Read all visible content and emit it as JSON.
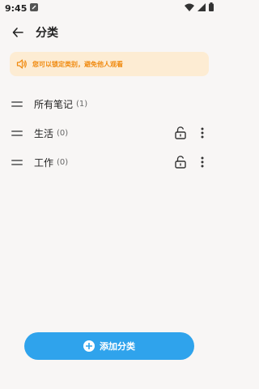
{
  "status": {
    "time": "9:45"
  },
  "header": {
    "title": "分类"
  },
  "tip": {
    "text": "您可以锁定类别，避免他人观看"
  },
  "categories": [
    {
      "name": "所有笔记",
      "count": "(1)",
      "lockable": false
    },
    {
      "name": "生活",
      "count": "(0)",
      "lockable": true
    },
    {
      "name": "工作",
      "count": "(0)",
      "lockable": true
    }
  ],
  "add_button": {
    "label": "添加分类"
  },
  "colors": {
    "accent": "#2fa3ec",
    "tip_bg": "#fdecd3",
    "tip_text": "#f08a0f",
    "background": "#f8f6f5"
  }
}
